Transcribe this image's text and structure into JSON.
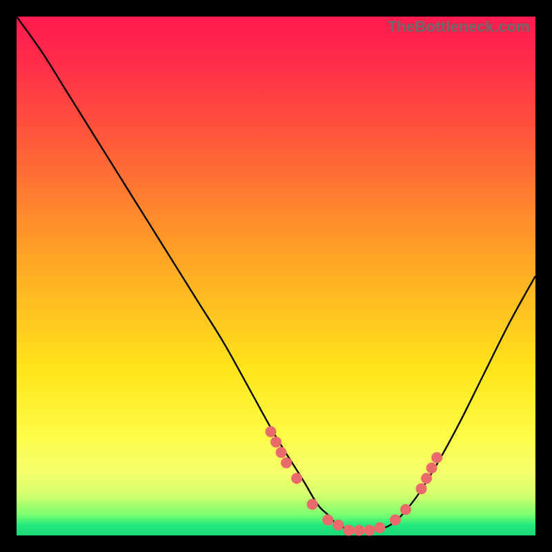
{
  "watermark": "TheBottleneck.com",
  "chart_data": {
    "type": "line",
    "title": "",
    "xlabel": "",
    "ylabel": "",
    "xlim": [
      0,
      100
    ],
    "ylim": [
      0,
      100
    ],
    "grid": false,
    "legend": false,
    "series": [
      {
        "name": "bottleneck-curve",
        "color": "#000000",
        "x": [
          0,
          5,
          10,
          15,
          20,
          25,
          30,
          35,
          40,
          45,
          50,
          55,
          58,
          60,
          62,
          65,
          68,
          72,
          76,
          80,
          85,
          90,
          95,
          100
        ],
        "values": [
          100,
          93,
          85,
          77,
          69,
          61,
          53,
          45,
          37,
          28,
          19,
          11,
          6,
          4,
          2,
          1,
          1,
          2,
          6,
          12,
          21,
          31,
          41,
          50
        ]
      }
    ],
    "markers": {
      "name": "highlighted-points",
      "color": "#e96a6a",
      "radius_px": 8,
      "points": [
        {
          "x": 49,
          "y": 20
        },
        {
          "x": 50,
          "y": 18
        },
        {
          "x": 51,
          "y": 16
        },
        {
          "x": 52,
          "y": 14
        },
        {
          "x": 54,
          "y": 11
        },
        {
          "x": 57,
          "y": 6
        },
        {
          "x": 60,
          "y": 3
        },
        {
          "x": 62,
          "y": 2
        },
        {
          "x": 64,
          "y": 1
        },
        {
          "x": 66,
          "y": 1
        },
        {
          "x": 68,
          "y": 1
        },
        {
          "x": 70,
          "y": 1.5
        },
        {
          "x": 73,
          "y": 3
        },
        {
          "x": 75,
          "y": 5
        },
        {
          "x": 78,
          "y": 9
        },
        {
          "x": 79,
          "y": 11
        },
        {
          "x": 80,
          "y": 13
        },
        {
          "x": 81,
          "y": 15
        }
      ]
    },
    "gradient_stops": [
      {
        "pct": 0,
        "color": "#ff1a4d"
      },
      {
        "pct": 46,
        "color": "#ffa325"
      },
      {
        "pct": 80,
        "color": "#fffb44"
      },
      {
        "pct": 96,
        "color": "#7cff6e"
      },
      {
        "pct": 100,
        "color": "#18d877"
      }
    ]
  }
}
